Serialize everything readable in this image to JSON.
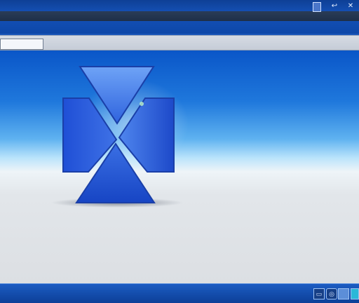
{
  "window": {
    "title": "",
    "toolbar_text": "",
    "address_value": ""
  },
  "icons": {
    "restore": "restore-icon",
    "back": "back-arrow-icon",
    "close": "close-icon",
    "logo": "blue-x-logo",
    "tray": [
      "monitor-icon",
      "settings-icon",
      "window-icon",
      "notification-icon"
    ]
  },
  "colors": {
    "titlebar": "#1552b8",
    "logo_blue": "#1e4fd8",
    "logo_light": "#5b95f2",
    "taskbar": "#0c3e96"
  }
}
